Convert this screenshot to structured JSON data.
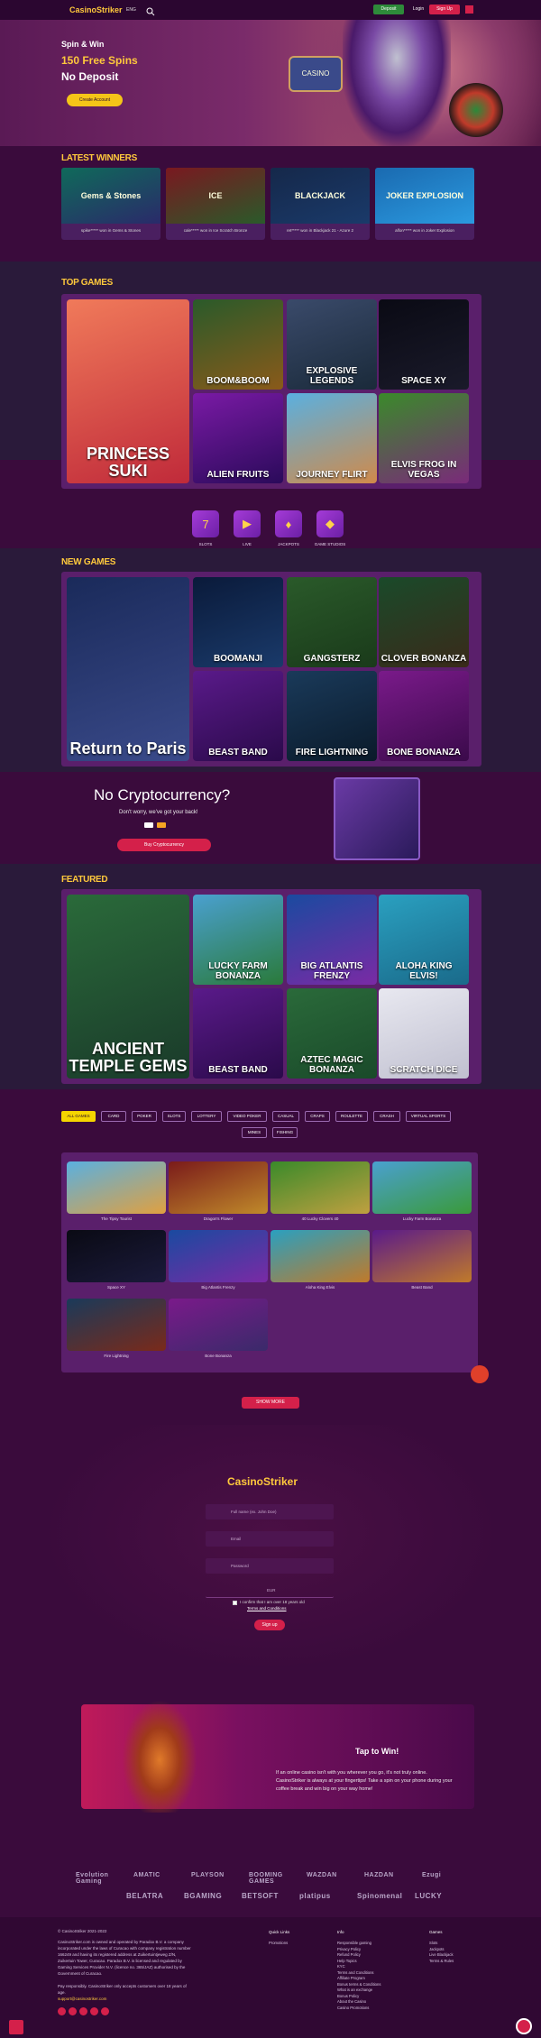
{
  "header": {
    "logo_brand": "CasinoStriker",
    "lang": "ENG",
    "deposit": "Deposit",
    "login": "Login",
    "signup": "Sign Up"
  },
  "hero": {
    "line1": "Spin & Win",
    "line2": "150 Free Spins",
    "line3": "No Deposit",
    "cta": "Create Account",
    "sign_text": "CASINO"
  },
  "latest_winners": {
    "title": "LATEST WINNERS",
    "items": [
      {
        "game": "Gems & Stones",
        "text": "spike***** won in Gems & Stones",
        "c1": "#0f6a5a",
        "c2": "#2a2a6a"
      },
      {
        "game": "ICE",
        "text": "cale***** won in Ice Scratch Bronze",
        "c1": "#7a1820",
        "c2": "#2a5a2a"
      },
      {
        "game": "BLACKJACK",
        "text": "ret***** won in Blackjack 21 - Azure 2",
        "c1": "#15284a",
        "c2": "#1a3a6a"
      },
      {
        "game": "JOKER EXPLOSION",
        "text": "alfon***** won in Joker Explosion",
        "c1": "#1a6ab0",
        "c2": "#2b9ae0"
      }
    ]
  },
  "top_games": {
    "title": "TOP GAMES",
    "items": [
      {
        "name": "PRINCESS SUKI",
        "c1": "#f07a5a",
        "c2": "#c02a3a"
      },
      {
        "name": "BOOM&BOOM",
        "c1": "#2a5a2a",
        "c2": "#8a5a1a"
      },
      {
        "name": "EXPLOSIVE LEGENDS",
        "c1": "#3a4a6a",
        "c2": "#1a2a3a"
      },
      {
        "name": "SPACE XY",
        "c1": "#0a0a14",
        "c2": "#1a1a2a"
      },
      {
        "name": "ALIEN FRUITS",
        "c1": "#7a1aa5",
        "c2": "#2a0a5a"
      },
      {
        "name": "JOURNEY FLIRT",
        "c1": "#5ab0e0",
        "c2": "#d08a4a"
      },
      {
        "name": "ELVIS FROG IN VEGAS",
        "c1": "#3a8a2a",
        "c2": "#7a2a7a"
      }
    ]
  },
  "categories": [
    {
      "label": "SLOTS",
      "glyph": "7"
    },
    {
      "label": "LIVE",
      "glyph": "▶"
    },
    {
      "label": "JACKPOTS",
      "glyph": "♦"
    },
    {
      "label": "GAME STUDIOS",
      "glyph": "◆"
    }
  ],
  "new_games": {
    "title": "NEW GAMES",
    "items": [
      {
        "name": "Return to Paris",
        "c1": "#1a2a5a",
        "c2": "#3a4a8a"
      },
      {
        "name": "BOOMANJI",
        "c1": "#0a1a3a",
        "c2": "#1a3a6a"
      },
      {
        "name": "GANGSTERZ",
        "c1": "#2a5a2a",
        "c2": "#1a3a1a"
      },
      {
        "name": "CLOVER BONANZA",
        "c1": "#1a4a2a",
        "c2": "#3a2a1a"
      },
      {
        "name": "BEAST BAND",
        "c1": "#5a1a8a",
        "c2": "#2a0a4a"
      },
      {
        "name": "FIRE LIGHTNING",
        "c1": "#1a3a5a",
        "c2": "#0a1a2a"
      },
      {
        "name": "BONE BONANZA",
        "c1": "#7a1a8a",
        "c2": "#3a0a4a"
      }
    ]
  },
  "crypto": {
    "title": "No Cryptocurrency?",
    "subtitle": "Don't worry, we've got your back!",
    "button": "Buy Cryptocurrency"
  },
  "featured": {
    "title": "FEATURED",
    "items": [
      {
        "name": "ANCIENT TEMPLE GEMS",
        "c1": "#2a6a3a",
        "c2": "#1a3a2a"
      },
      {
        "name": "LUCKY FARM BONANZA",
        "c1": "#4aa0d0",
        "c2": "#2a7a3a"
      },
      {
        "name": "BIG ATLANTIS FRENZY",
        "c1": "#1a4aa0",
        "c2": "#7a2aa5"
      },
      {
        "name": "ALOHA KING ELVIS!",
        "c1": "#2aa0c0",
        "c2": "#1a6a8a"
      },
      {
        "name": "BEAST BAND",
        "c1": "#5a1a8a",
        "c2": "#2a0a4a"
      },
      {
        "name": "AZTEC MAGIC BONANZA",
        "c1": "#2a6a3a",
        "c2": "#1a4a2a"
      },
      {
        "name": "SCRATCH DICE",
        "c1": "#e8e8f0",
        "c2": "#c0c0d0"
      }
    ]
  },
  "filters": [
    "ALL GAMES",
    "CARD",
    "POKER",
    "SLOTS",
    "LOTTERY",
    "VIDEO POKER",
    "CASUAL",
    "CRAPS",
    "ROULETTE",
    "CRASH",
    "VIRTUAL SPORTS",
    "MINES",
    "FISHING"
  ],
  "grid_games": [
    {
      "name": "The Tipsy Tourist",
      "c1": "#5ab0e0",
      "c2": "#e0a040"
    },
    {
      "name": "Dragon's Flower",
      "c1": "#7a1a1a",
      "c2": "#c08a2a"
    },
    {
      "name": "40 Lucky Clovers 40",
      "c1": "#3a8a2a",
      "c2": "#c0a040"
    },
    {
      "name": "Lucky Farm Bonanza",
      "c1": "#4aa0d0",
      "c2": "#3a9a3a"
    },
    {
      "name": "Space XY",
      "c1": "#0a0a14",
      "c2": "#1a1a3a"
    },
    {
      "name": "Big Atlantis Frenzy",
      "c1": "#1a4aa0",
      "c2": "#7a2aa5"
    },
    {
      "name": "Aloha King Elvis",
      "c1": "#2aa0c0",
      "c2": "#c07a2a"
    },
    {
      "name": "Beast Band",
      "c1": "#5a1a8a",
      "c2": "#c07a2a"
    },
    {
      "name": "Fire Lightning",
      "c1": "#1a3a5a",
      "c2": "#7a2a1a"
    },
    {
      "name": "Bone Bonanza",
      "c1": "#7a1a8a",
      "c2": "#3a2a6a"
    }
  ],
  "show_more": "SHOW MORE",
  "signup_form": {
    "brand": "CasinoStriker",
    "name_ph": "Full name (ex. John Doe)",
    "email_ph": "Email",
    "password_ph": "Password",
    "currency": "EUR",
    "agree": "I confirm that I am over 18 years old",
    "terms": "Terms and Conditions",
    "button": "Sign up"
  },
  "tap": {
    "title": "Tap to Win!",
    "text": "If an online casino isn't with you wherever you go, it's not truly online. CasinoStriker is always at your fingertips! Take a spin on your phone during your coffee break and win big on your way home!"
  },
  "providers": [
    "Evolution Gaming",
    "AMATIC",
    "PLAYSON",
    "BOOMING GAMES",
    "WAZDAN",
    "HAZDAN",
    "Ezugi",
    "BELATRA",
    "BGAMING",
    "BETSOFT",
    "platipus",
    "Spinomenal",
    "LUCKY"
  ],
  "footer": {
    "copyright": "© CasinoStriker 2021-2022",
    "legal": "CasinoStriker.com is owned and operated by Paradox B.V. a company incorporated under the laws of Curacao with company registration number 166249 and having its registered address at Zuikertuintjeweg Z/N, Zuikertuin Tower, Curacao. Paradox B.V. is licensed and regulated by Gaming Services Provider N.V. (licence no. 365/JAZ) authorised by the Government of Curacao.",
    "email_note": "Pay responsibly. CasinoStriker only accepts customers over 18 years of age.",
    "email": "support@casinostriker.com",
    "col1_title": "Quick Links",
    "col1": [
      "Promotions"
    ],
    "col2_title": "Info",
    "col2": [
      "Responsible gaming",
      "Privacy Policy",
      "Refund Policy",
      "Help Topics",
      "KYC",
      "Terms and Conditions",
      "Affiliate Program",
      "Bonus terms & Conditions",
      "What is an exchange",
      "Bonus Policy",
      "About the Casino",
      "Casino Promotions"
    ],
    "col3_title": "Games",
    "col3": [
      "Slots",
      "Jackpots",
      "Live Blackjack",
      "Terms & Rules"
    ]
  }
}
